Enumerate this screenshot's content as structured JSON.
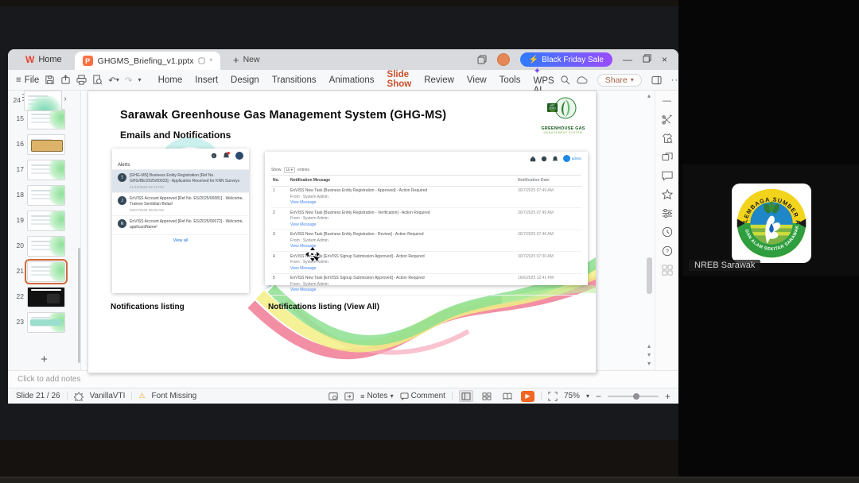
{
  "icons": {
    "plus": "+",
    "caret_down": "▾",
    "caret_up": "▴",
    "chevron_right": "›",
    "minimize": "—",
    "close": "×",
    "play": "▶",
    "lightning": "⚡",
    "hamburger": "≡",
    "asterisk": "*",
    "undo": "↶",
    "redo": "↷",
    "warning": "⚠",
    "minus": "−",
    "dots": "···"
  },
  "window": {
    "home_tab": "Home",
    "doc_title": "GHGMS_Briefing_v1.pptx",
    "new_label": "New",
    "promo_label": "Black Friday Sale",
    "file_label": "File",
    "share_label": "Share",
    "menus": [
      {
        "label": "Home",
        "kind": ""
      },
      {
        "label": "Insert",
        "kind": ""
      },
      {
        "label": "Design",
        "kind": ""
      },
      {
        "label": "Transitions",
        "kind": ""
      },
      {
        "label": "Animations",
        "kind": ""
      },
      {
        "label": "Slide Show",
        "kind": "active"
      },
      {
        "label": "Review",
        "kind": ""
      },
      {
        "label": "View",
        "kind": ""
      },
      {
        "label": "Tools",
        "kind": ""
      },
      {
        "label": "WPS AI",
        "kind": "ai"
      }
    ]
  },
  "slide_panel": {
    "thumbnails": [
      {
        "num": "15",
        "kind": ""
      },
      {
        "num": "16",
        "kind": "tan"
      },
      {
        "num": "17",
        "kind": ""
      },
      {
        "num": "18",
        "kind": ""
      },
      {
        "num": "19",
        "kind": ""
      },
      {
        "num": "20",
        "kind": ""
      },
      {
        "num": "21",
        "kind": "selected"
      },
      {
        "num": "22",
        "kind": "dark"
      },
      {
        "num": "23",
        "kind": "teal"
      },
      {
        "num": "24",
        "kind": "waves"
      }
    ]
  },
  "slide": {
    "title": "Sarawak Greenhouse Gas Management System (GHG-MS)",
    "subtitle": "Emails and Notifications",
    "logo": {
      "badge": "NET ZERO 2050",
      "line1": "GREENHOUSE GAS",
      "line2": "MANAGEMENT SYSTEM"
    },
    "captions": {
      "left": "Notifications listing",
      "right": "Notifications listing (View All)"
    },
    "alerts": {
      "header": "Alerts",
      "view_all": "View all",
      "items": [
        {
          "initial": "T",
          "kind": "highlight",
          "text": "[GHG-MS] Business Entity Registration [Ref No. GHG/BE/2025/00023] - Application Received for KNN Surveys",
          "time": "21/10/2025 02:19 PM"
        },
        {
          "initial": "J",
          "kind": "",
          "text": "EnVISS Account Approved [Ref No. ES/2025/00081] - Welcome, Trainee Sembilan Belas!",
          "time": "30/07/2025 09:09 AM"
        },
        {
          "initial": "N",
          "kind": "",
          "text": "EnVISS Account Approved [Ref No. ES/2025/00072] - Welcome, applicantName!",
          "time": ""
        }
      ]
    },
    "table": {
      "show_label": "Show",
      "page_size": "10",
      "entries_label": "entries",
      "user_label": "admin",
      "headers": {
        "no": "No.",
        "message": "Notification Message",
        "date": "Notification Date"
      },
      "rows": [
        {
          "no": "1",
          "message": "EnVISS New Task [Business Entity Registration - Approved] - Action Required",
          "from": "From : System Admin",
          "link": "View Message",
          "date": "30/7/2025 07:49 AM"
        },
        {
          "no": "2",
          "message": "EnVISS New Task [Business Entity Registration - Verification] - Action Required",
          "from": "From : System Admin",
          "link": "View Message",
          "date": "30/7/2025 07:49 AM"
        },
        {
          "no": "3",
          "message": "EnVISS New Task [Business Entity Registration - Review] - Action Required",
          "from": "From : System Admin",
          "link": "View Message",
          "date": "30/7/2025 07:46 AM"
        },
        {
          "no": "4",
          "message": "EnVISS New Task [EnVISS Signup Submission Approved] - Action Required",
          "from": "From : System Admin",
          "link": "View Message",
          "date": "30/7/2025 07:30 AM"
        },
        {
          "no": "5",
          "message": "EnVISS New Task [EnVISS Signup Submission Approved] - Action Required",
          "from": "From : System Admin",
          "link": "View Message",
          "date": "16/6/2025 12:41 PM"
        }
      ]
    }
  },
  "notes": {
    "placeholder": "Click to add notes"
  },
  "status_bar": {
    "slide_indicator": "Slide 21 / 26",
    "theme_name": "VanillaVTI",
    "font_missing": "Font Missing",
    "notes_label": "Notes",
    "comment_label": "Comment",
    "zoom_level": "75%"
  },
  "meeting": {
    "participant_name": "NREB Sarawak",
    "logo_top_text": "LEMBAGA SUMBER ASLI",
    "logo_bottom_text": "DAN ALAM SEKITAR SARAWAK"
  },
  "colors": {
    "accent_orange": "#c9502b",
    "promo_start": "#2f7bff",
    "promo_end": "#9a4dff",
    "play_button": "#f26522",
    "link_blue": "#4285f4",
    "selected_thumb": "#d0693c",
    "alert_highlight": "#dde4ec",
    "teal_decor": "#7ed9d2"
  }
}
